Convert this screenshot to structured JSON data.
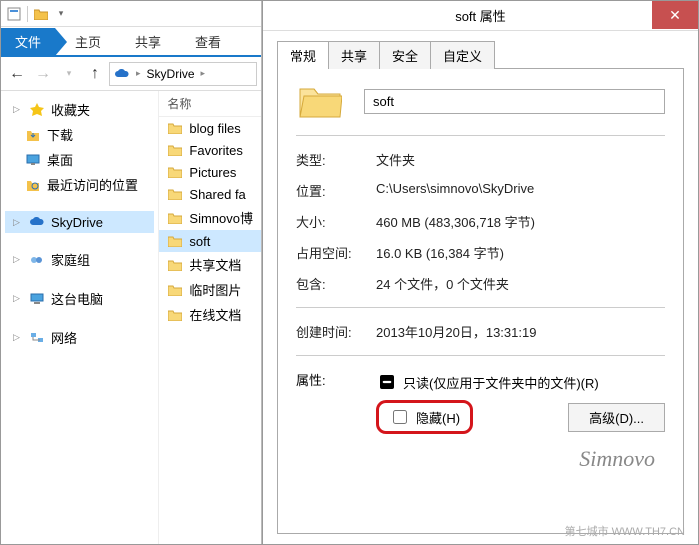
{
  "explorer": {
    "tabs": {
      "file": "文件",
      "home": "主页",
      "share": "共享",
      "view": "查看"
    },
    "address": {
      "root": "SkyDrive"
    },
    "nav": {
      "favorites": {
        "label": "收藏夹",
        "items": [
          "下载",
          "桌面",
          "最近访问的位置"
        ]
      },
      "skydrive": "SkyDrive",
      "homegroup": "家庭组",
      "thispc": "这台电脑",
      "network": "网络"
    },
    "column_header": "名称",
    "files": [
      "blog files",
      "Favorites",
      "Pictures",
      "Shared fa",
      "Simnovo博",
      "soft",
      "共享文档",
      "临时图片",
      "在线文档"
    ]
  },
  "props": {
    "title": "soft 属性",
    "tabs": [
      "常规",
      "共享",
      "安全",
      "自定义"
    ],
    "folder_name": "soft",
    "rows": {
      "type": {
        "k": "类型:",
        "v": "文件夹"
      },
      "location": {
        "k": "位置:",
        "v": "C:\\Users\\simnovo\\SkyDrive"
      },
      "size": {
        "k": "大小:",
        "v": "460 MB (483,306,718 字节)"
      },
      "ondisk": {
        "k": "占用空间:",
        "v": "16.0 KB (16,384 字节)"
      },
      "contains": {
        "k": "包含:",
        "v": "24 个文件，0 个文件夹"
      },
      "created": {
        "k": "创建时间:",
        "v": "2013年10月20日，13:31:19"
      },
      "attrs": {
        "k": "属性:"
      }
    },
    "readonly_label": "只读(仅应用于文件夹中的文件)(R)",
    "hidden_label": "隐藏(H)",
    "advanced_label": "高级(D)...",
    "watermark": "Simnovo",
    "footer": "第七城市 WWW.TH7.CN"
  }
}
